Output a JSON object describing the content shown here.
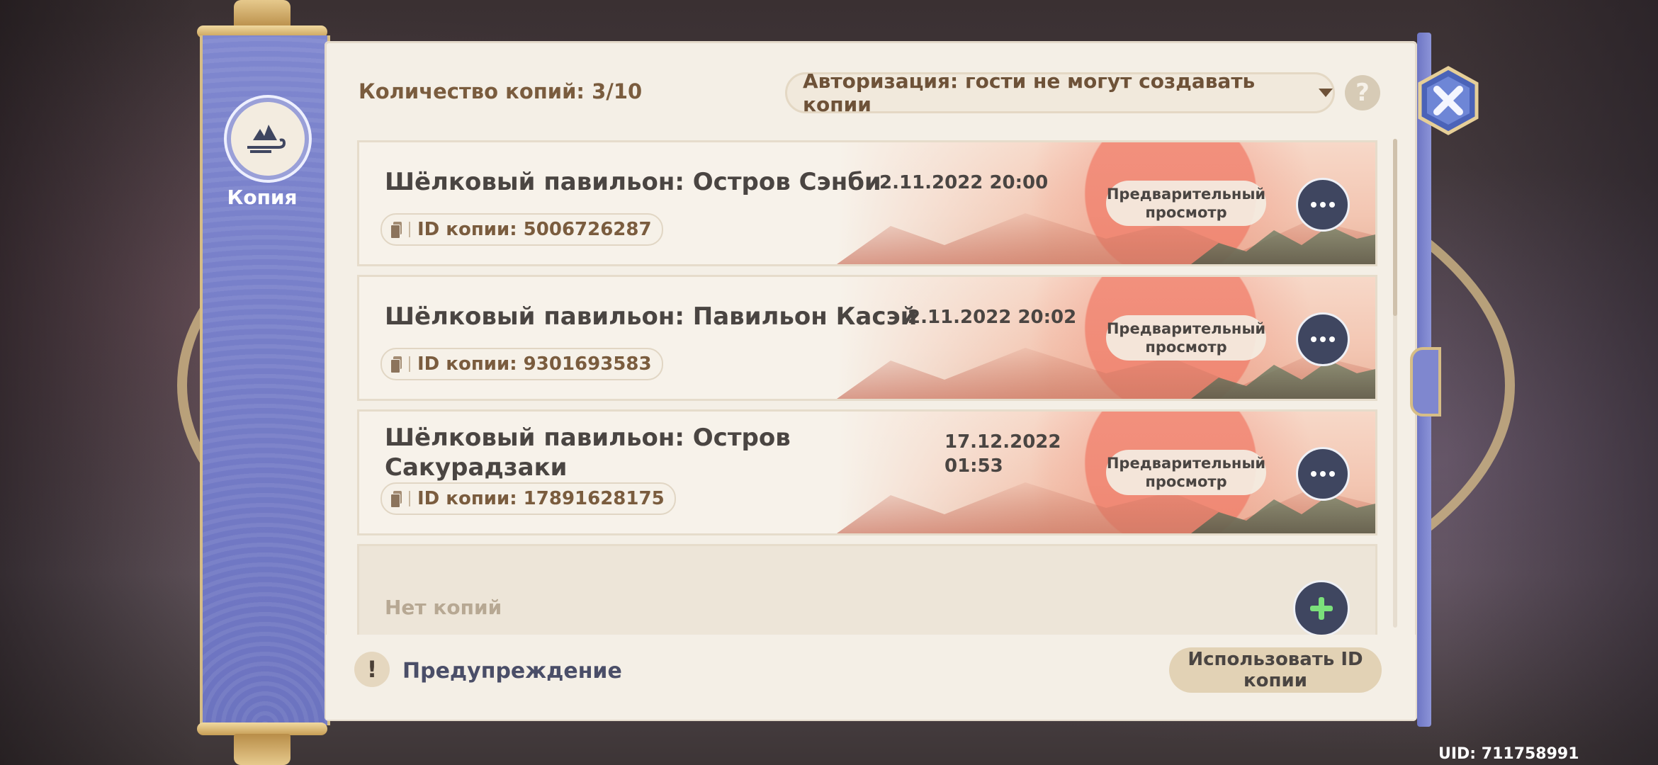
{
  "sidebar": {
    "label": "Копия"
  },
  "header": {
    "copy_count": "Количество копий: 3/10",
    "authorization": "Авторизация: гости не могут создавать копии",
    "help": "?"
  },
  "copies": [
    {
      "title": "Шёлковый павильон: Остров Сэнби",
      "date": "2.11.2022 20:00",
      "id_label": "ID копии: 5006726287",
      "preview": "Предварительный просмотр"
    },
    {
      "title": "Шёлковый павильон: Павильон Касэй",
      "date": "2.11.2022 20:02",
      "id_label": "ID копии: 9301693583",
      "preview": "Предварительный просмотр"
    },
    {
      "title": "Шёлковый павильон: Остров Сакурадзаки",
      "date": "17.12.2022 01:53",
      "id_label": "ID копии: 17891628175",
      "preview": "Предварительный просмотр"
    }
  ],
  "empty_slot": {
    "label": "Нет копий"
  },
  "footer": {
    "warning": "Предупреждение",
    "warning_icon": "!",
    "use_id_button": "Использовать ID копии"
  },
  "uid": "UID: 711758991",
  "icons": {
    "emblem": "copy-emblem-icon",
    "copy": "copy-icon",
    "more": "more-icon",
    "add": "plus-icon",
    "close": "close-icon"
  },
  "colors": {
    "sidebar": "#7f87cf",
    "panel": "#f4efe6",
    "button_dark": "#3f4660",
    "add_plus": "#7be07b",
    "label_brown": "#7a5c3e"
  }
}
